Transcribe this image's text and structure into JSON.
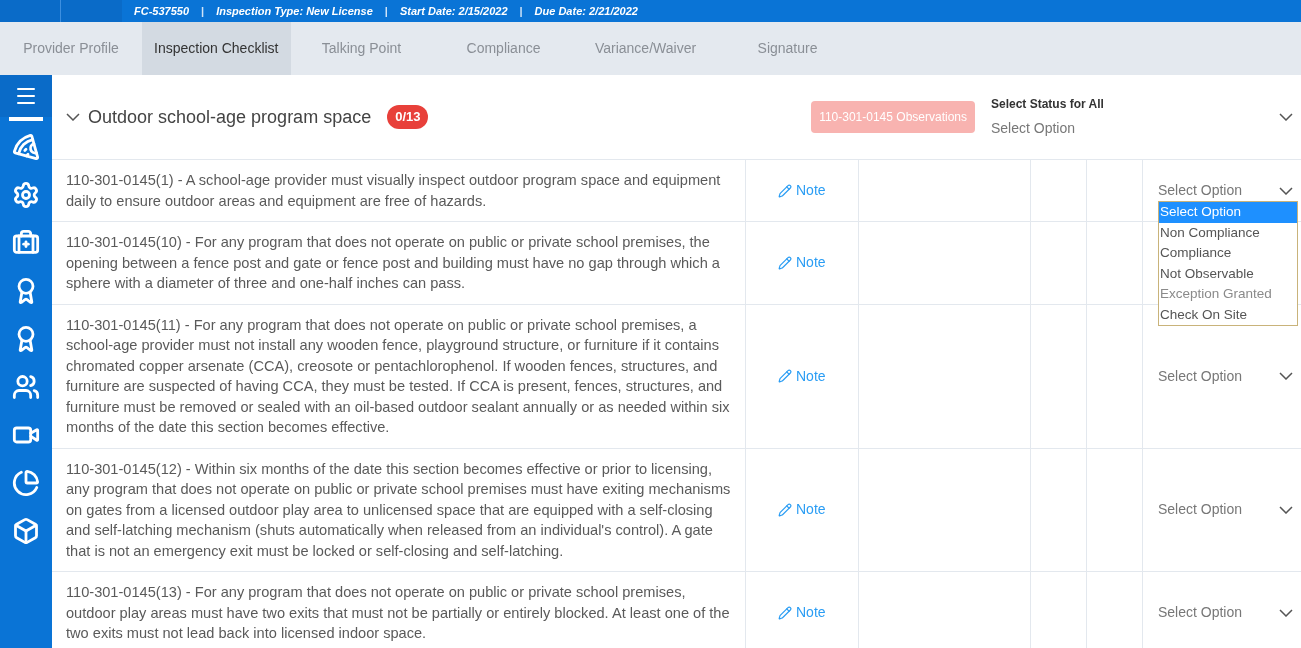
{
  "header": {
    "items": [
      {
        "kind": "info",
        "text": "FC-537550"
      },
      {
        "kind": "separator",
        "text": "|"
      },
      {
        "kind": "info",
        "text": "Inspection Type: New License"
      },
      {
        "kind": "separator",
        "text": "|"
      },
      {
        "kind": "info",
        "text": "Start Date: 2/15/2022"
      },
      {
        "kind": "separator",
        "text": "|"
      },
      {
        "kind": "info",
        "text": "Due Date: 2/21/2022"
      }
    ]
  },
  "tabs": [
    {
      "label": "Provider Profile",
      "selected": false
    },
    {
      "label": "Inspection Checklist",
      "selected": true
    },
    {
      "label": "Talking Point",
      "selected": false
    },
    {
      "label": "Compliance",
      "selected": false
    },
    {
      "label": "Variance/Waiver",
      "selected": false
    },
    {
      "label": "Signature",
      "selected": false
    }
  ],
  "section": {
    "title": "Outdoor school-age program space",
    "expanded": true,
    "badge": "0/13",
    "observations_button": "110-301-0145 Observations",
    "select_all_label": "Select Status for All",
    "select_all_value": "Select Option"
  },
  "rows": [
    {
      "text": "110-301-0145(1) - A school-age provider must visually inspect outdoor program space and equipment daily to ensure outdoor areas and equipment are free of hazards.",
      "note": "Note",
      "status": "Select Option",
      "options": [
        {
          "label": "Select Option",
          "selected": true,
          "disabled": false
        },
        {
          "label": "Non Compliance",
          "selected": false,
          "disabled": false
        },
        {
          "label": "Compliance",
          "selected": false,
          "disabled": false
        },
        {
          "label": "Not Observable",
          "selected": false,
          "disabled": false
        },
        {
          "label": "Exception Granted",
          "selected": false,
          "disabled": true
        },
        {
          "label": "Check On Site",
          "selected": false,
          "disabled": false
        }
      ]
    },
    {
      "text": "110-301-0145(10) - For any program that does not operate on public or private school premises, the opening between a fence post and gate or fence post and building must have no gap through which a sphere with a diameter of three and one-half inches can pass.",
      "note": "Note"
    },
    {
      "text": "110-301-0145(11) - For any program that does not operate on public or private school premises, a school-age provider must not install any wooden fence, playground structure, or furniture if it contains chromated copper arsenate (CCA), creosote or pentachlorophenol. If wooden fences, structures, and furniture are suspected of having CCA, they must be tested. If CCA is present, fences, structures, and furniture must be removed or sealed with an oil-based outdoor sealant annually or as needed within six months of the date this section becomes effective.",
      "note": "Note",
      "status": "Select Option"
    },
    {
      "text": "110-301-0145(12) - Within six months of the date this section becomes effective or prior to licensing, any program that does not operate on public or private school premises must have exiting mechanisms on gates from a licensed outdoor play area to unlicensed space that are equipped with a self-closing and self-latching mechanism (shuts automatically when released from an individual's control). A gate that is not an emergency exit must be locked or self-closing and self-latching.",
      "note": "Note",
      "status": "Select Option"
    },
    {
      "text": "110-301-0145(13) - For any program that does not operate on public or private school premises, outdoor play areas must have two exits that must not be partially or entirely blocked. At least one of the two exits must not lead back into licensed indoor space.",
      "note": "Note",
      "status": "Select Option"
    }
  ]
}
